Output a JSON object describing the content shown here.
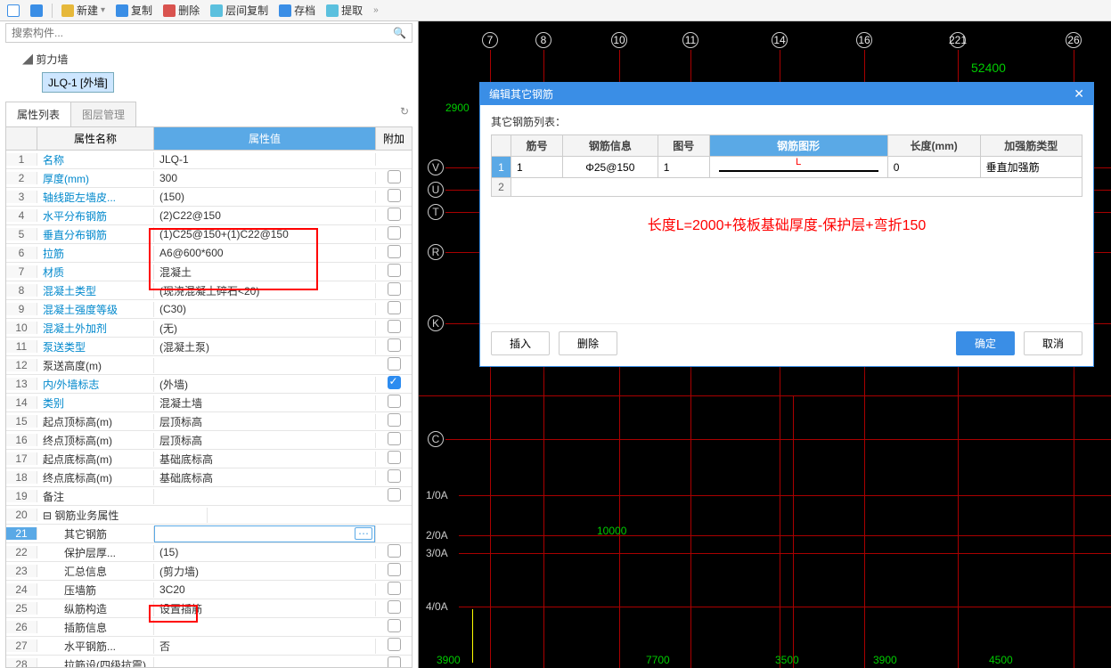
{
  "toolbar": {
    "new": "新建",
    "copy": "复制",
    "delete": "删除",
    "layer_copy": "层间复制",
    "archive": "存档",
    "extract": "提取"
  },
  "search": {
    "placeholder": "搜索构件..."
  },
  "tree": {
    "root": "剪力墙",
    "item": "JLQ-1 [外墙]"
  },
  "tabs": {
    "props": "属性列表",
    "layers": "图层管理"
  },
  "prop_header": {
    "name": "属性名称",
    "value": "属性值",
    "extra": "附加"
  },
  "props": [
    {
      "n": "1",
      "name": "名称",
      "val": "JLQ-1",
      "link": true
    },
    {
      "n": "2",
      "name": "厚度(mm)",
      "val": "300",
      "link": true,
      "chk": false
    },
    {
      "n": "3",
      "name": "轴线距左墙皮...",
      "val": "(150)",
      "link": true,
      "chk": false
    },
    {
      "n": "4",
      "name": "水平分布钢筋",
      "val": "(2)C22@150",
      "link": true,
      "chk": false
    },
    {
      "n": "5",
      "name": "垂直分布钢筋",
      "val": "(1)C25@150+(1)C22@150",
      "link": true,
      "chk": false
    },
    {
      "n": "6",
      "name": "拉筋",
      "val": "A6@600*600",
      "link": true,
      "chk": false
    },
    {
      "n": "7",
      "name": "材质",
      "val": "混凝土",
      "link": true,
      "chk": false
    },
    {
      "n": "8",
      "name": "混凝土类型",
      "val": "(现浇混凝土碎石<20)",
      "link": true,
      "chk": false
    },
    {
      "n": "9",
      "name": "混凝土强度等级",
      "val": "(C30)",
      "link": true,
      "chk": false
    },
    {
      "n": "10",
      "name": "混凝土外加剂",
      "val": "(无)",
      "link": true,
      "chk": false
    },
    {
      "n": "11",
      "name": "泵送类型",
      "val": "(混凝土泵)",
      "link": true,
      "chk": false
    },
    {
      "n": "12",
      "name": "泵送高度(m)",
      "val": "",
      "link": false,
      "chk": false
    },
    {
      "n": "13",
      "name": "内/外墙标志",
      "val": "(外墙)",
      "link": true,
      "chk": true
    },
    {
      "n": "14",
      "name": "类别",
      "val": "混凝土墙",
      "link": true,
      "chk": false
    },
    {
      "n": "15",
      "name": "起点顶标高(m)",
      "val": "层顶标高",
      "link": false,
      "chk": false
    },
    {
      "n": "16",
      "name": "终点顶标高(m)",
      "val": "层顶标高",
      "link": false,
      "chk": false
    },
    {
      "n": "17",
      "name": "起点底标高(m)",
      "val": "基础底标高",
      "link": false,
      "chk": false
    },
    {
      "n": "18",
      "name": "终点底标高(m)",
      "val": "基础底标高",
      "link": false,
      "chk": false
    },
    {
      "n": "19",
      "name": "备注",
      "val": "",
      "link": false,
      "chk": false
    },
    {
      "n": "20",
      "name": "钢筋业务属性",
      "val": "",
      "section": true
    },
    {
      "n": "21",
      "name": "其它钢筋",
      "val": "",
      "indent": true,
      "active": true
    },
    {
      "n": "22",
      "name": "保护层厚...",
      "val": "(15)",
      "indent": true,
      "chk": false
    },
    {
      "n": "23",
      "name": "汇总信息",
      "val": "(剪力墙)",
      "indent": true,
      "chk": false
    },
    {
      "n": "24",
      "name": "压墙筋",
      "val": "3C20",
      "indent": true,
      "chk": false
    },
    {
      "n": "25",
      "name": "纵筋构造",
      "val": "设置插筋",
      "indent": true,
      "chk": false
    },
    {
      "n": "26",
      "name": "插筋信息",
      "val": "",
      "indent": true,
      "chk": false
    },
    {
      "n": "27",
      "name": "水平钢筋...",
      "val": "否",
      "indent": true,
      "chk": false
    },
    {
      "n": "28",
      "name": "拉筋设(四级抗震)",
      "val": "",
      "indent": true,
      "chk": false
    }
  ],
  "canvas": {
    "top_numbers": [
      "7",
      "8",
      "10",
      "11",
      "14",
      "16",
      "221",
      "26"
    ],
    "top_dim": "52400",
    "left_letters": [
      "V",
      "U",
      "T",
      "R",
      "K",
      "C"
    ],
    "left_labels": [
      "1/0A",
      "2/0A",
      "3/0A",
      "4/0A"
    ],
    "bottom_dims": [
      "3900",
      "7700",
      "3500",
      "3900",
      "4500"
    ],
    "mid_dim": "10000",
    "corner_dim": "2900"
  },
  "dialog": {
    "title": "编辑其它钢筋",
    "list_label": "其它钢筋列表：",
    "headers": {
      "no": "筋号",
      "info": "钢筋信息",
      "fig_no": "图号",
      "shape": "钢筋图形",
      "length": "长度(mm)",
      "type": "加强筋类型"
    },
    "row": {
      "no": "1",
      "info": "Φ25@150",
      "fig_no": "1",
      "shape_label": "L",
      "length": "0",
      "type": "垂直加强筋"
    },
    "note": "长度L=2000+筏板基础厚度-保护层+弯折150",
    "btns": {
      "insert": "插入",
      "delete": "删除",
      "ok": "确定",
      "cancel": "取消"
    }
  }
}
